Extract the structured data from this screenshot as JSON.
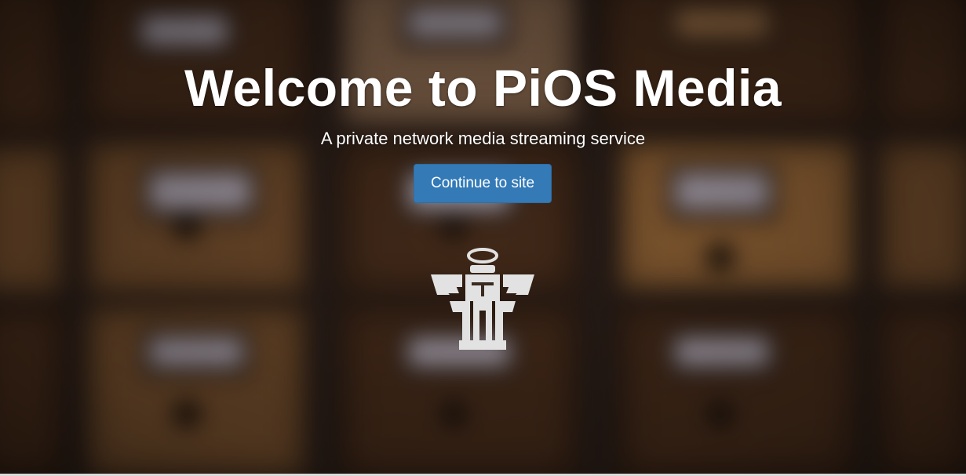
{
  "hero": {
    "title": "Welcome to PiOS Media",
    "subtitle": "A private network media streaming service",
    "button_label": "Continue to site"
  },
  "logo": {
    "icon": "pios-robot-angel-logo",
    "color": "#e0e0e0"
  },
  "colors": {
    "button": "#337ab7",
    "text": "#ffffff"
  }
}
